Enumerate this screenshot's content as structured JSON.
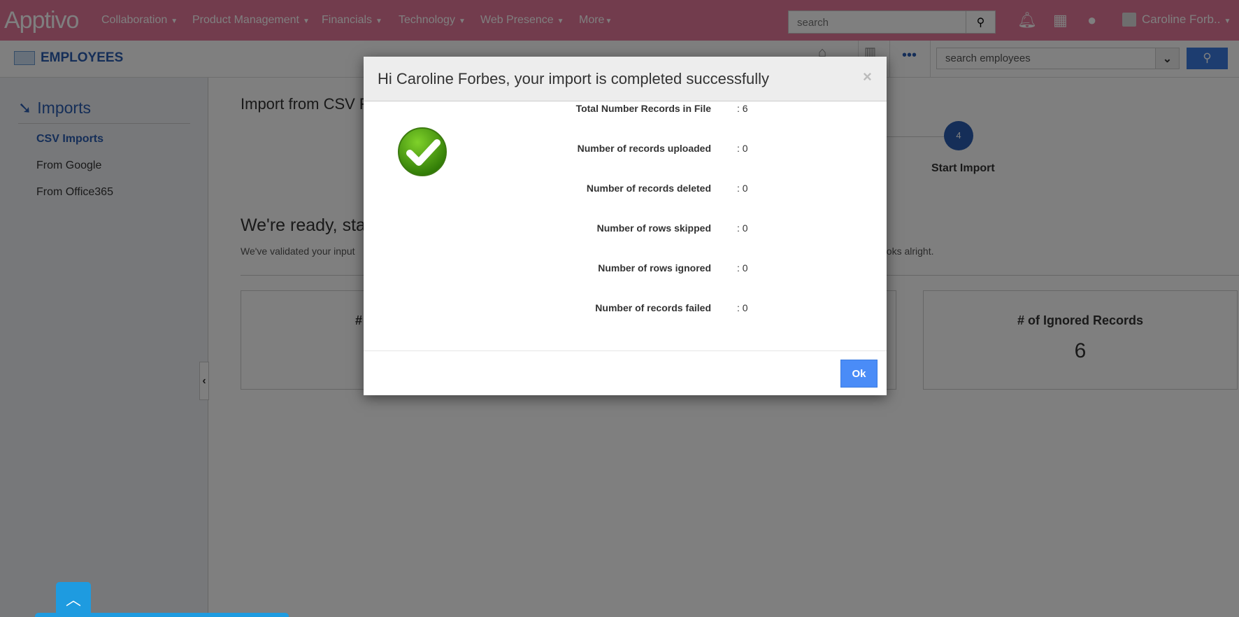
{
  "app": {
    "logo": "Apptivo"
  },
  "nav": {
    "items": [
      "Collaboration",
      "Product Management",
      "Financials",
      "Technology",
      "Web Presence",
      "More"
    ],
    "search_placeholder": "search",
    "user": "Caroline Forb.."
  },
  "subheader": {
    "title": "EMPLOYEES",
    "search_placeholder": "search employees",
    "more": "•••"
  },
  "sidebar": {
    "heading": "Imports",
    "items": [
      "CSV Imports",
      "From Google",
      "From Office365"
    ]
  },
  "main": {
    "title": "Import from CSV F",
    "step_number": "4",
    "step_label": "Start Import",
    "ready_heading": "We're ready, sta",
    "ready_text_start": "We've validated your input",
    "ready_text_end": "ooks alright.",
    "card1_label": "#",
    "card2_label": "# of Ignored Records",
    "card2_value": "6"
  },
  "modal": {
    "title": "Hi Caroline Forbes, your import is completed successfully",
    "close": "×",
    "rows": [
      {
        "label": "Total Number Records in File",
        "value": ": 6"
      },
      {
        "label": "Number of records uploaded",
        "value": ": 0"
      },
      {
        "label": "Number of records deleted",
        "value": ": 0"
      },
      {
        "label": "Number of rows skipped",
        "value": ": 0"
      },
      {
        "label": "Number of rows ignored",
        "value": ": 0"
      },
      {
        "label": "Number of records failed",
        "value": ": 0"
      }
    ],
    "ok_label": "Ok"
  },
  "colors": {
    "nav": "#e4789a",
    "accent": "#2a5db0",
    "ok": "#4a8cf7",
    "scroll_top": "#1e9be0"
  }
}
